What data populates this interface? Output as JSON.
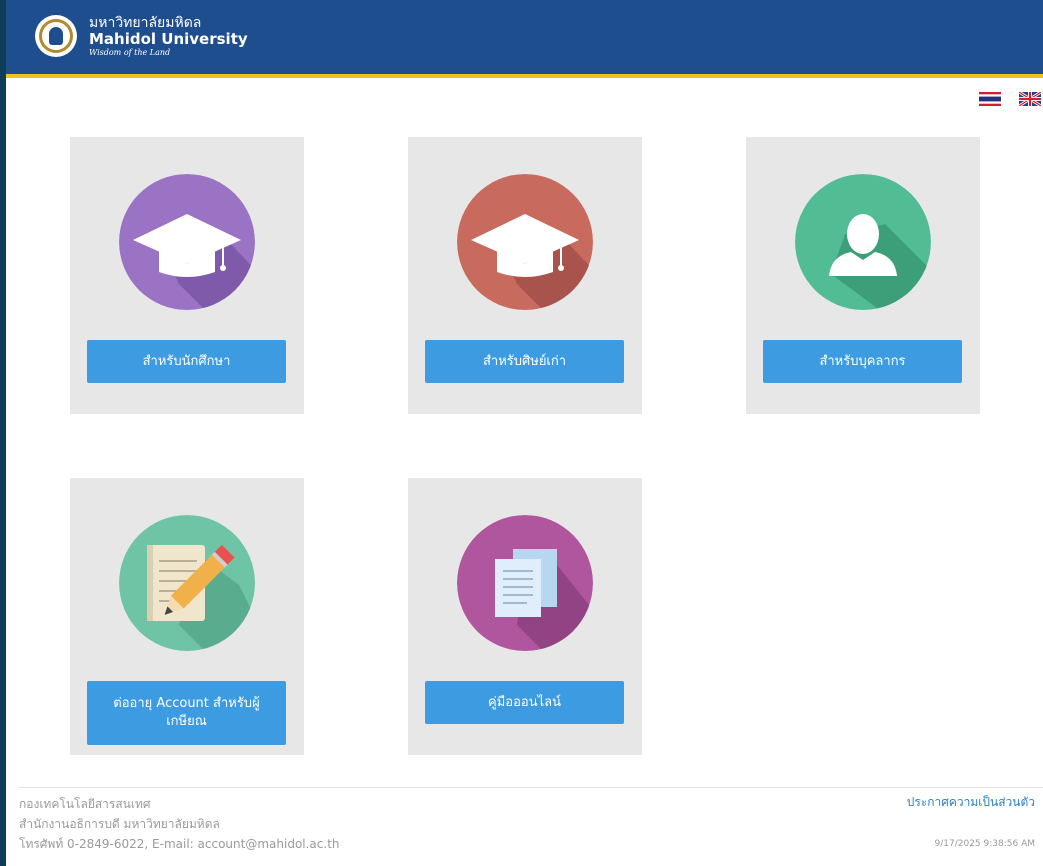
{
  "header": {
    "logo_th": "มหาวิทยาลัยมหิดล",
    "logo_en": "Mahidol University",
    "logo_motto": "Wisdom of the Land"
  },
  "language": {
    "th_flag": "thai-flag-icon",
    "en_flag": "uk-flag-icon"
  },
  "cards": [
    {
      "label": "สำหรับนักศึกษา",
      "icon": "graduation-cap-icon",
      "color": "#9a73c4"
    },
    {
      "label": "สำหรับศิษย์เก่า",
      "icon": "graduation-cap-icon",
      "color": "#c96a5e"
    },
    {
      "label": "สำหรับบุคลากร",
      "icon": "user-silhouette-icon",
      "color": "#52bd95"
    },
    {
      "label": "ต่ออายุ Account สำหรับผู้เกษียณ",
      "icon": "notepad-pencil-icon",
      "color": "#6ec4a4"
    },
    {
      "label": "คู่มือออนไลน์",
      "icon": "documents-icon",
      "color": "#b0569e"
    }
  ],
  "footer": {
    "line1": "กองเทคโนโลยีสารสนเทศ",
    "line2": "สำนักงานอธิการบดี มหาวิทยาลัยมหิดล",
    "line3": "โทรศัพท์ 0-2849-6022, E-mail: account@mahidol.ac.th",
    "privacy_link": "ประกาศความเป็นส่วนตัว",
    "timestamp": "9/17/2025 9:38:56 AM"
  },
  "colors": {
    "header_bg": "#1f4e8f",
    "header_accent": "#f2c316",
    "button_bg": "#3c9be1",
    "card_bg": "#e7e7e7"
  }
}
